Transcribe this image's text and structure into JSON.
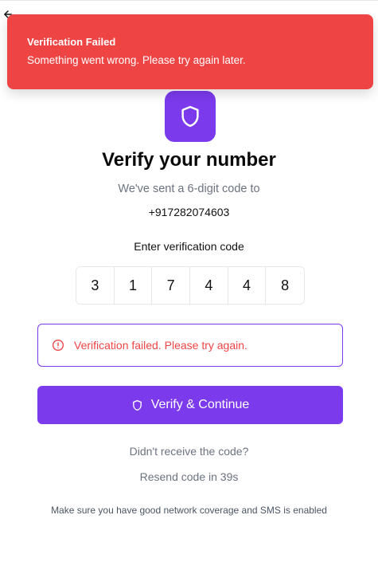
{
  "toast": {
    "title": "Verification Failed",
    "message": "Something went wrong. Please try again later."
  },
  "header": {
    "back_icon": "arrow-left-icon"
  },
  "hero": {
    "icon": "shield-icon",
    "title": "Verify your number",
    "subtitle": "We've sent a 6-digit code to",
    "phone": "+917282074603"
  },
  "code": {
    "label": "Enter verification code",
    "digits": [
      "3",
      "1",
      "7",
      "4",
      "4",
      "8"
    ]
  },
  "alert": {
    "icon": "alert-circle-icon",
    "message": "Verification failed. Please try again."
  },
  "actions": {
    "verify_label": "Verify & Continue",
    "verify_icon": "shield-icon"
  },
  "resend": {
    "prompt": "Didn't receive the code?",
    "countdown": "Resend code in 39s"
  },
  "footer": {
    "note": "Make sure you have good network coverage and SMS is enabled"
  },
  "colors": {
    "accent": "#7c3aed",
    "error": "#ef4444",
    "muted": "#6b7280"
  }
}
